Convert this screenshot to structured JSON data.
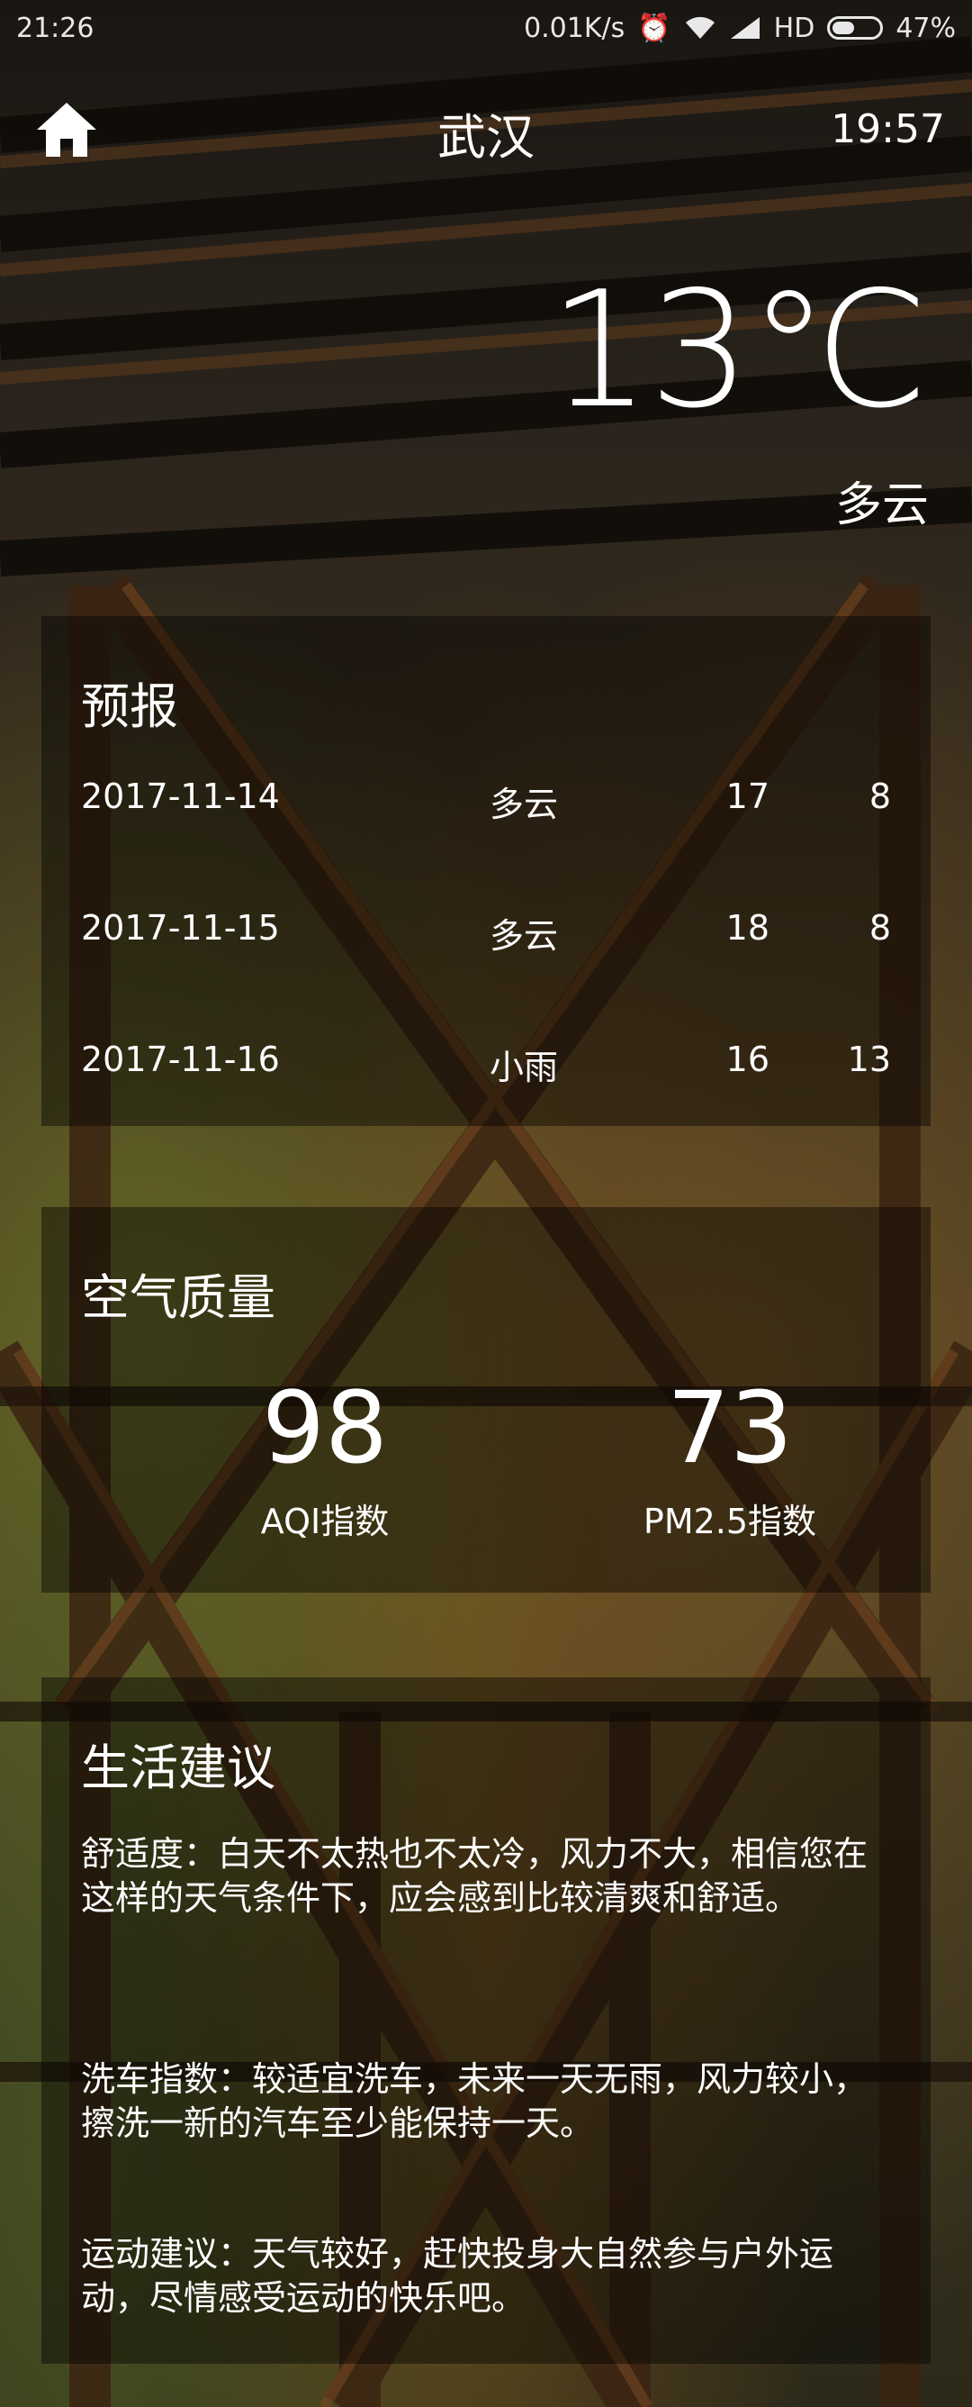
{
  "status_bar": {
    "time": "21:26",
    "net_speed": "0.01K/s",
    "alarm_icon": "alarm-icon",
    "wifi_icon": "wifi-icon",
    "signal_icon": "signal-icon",
    "network_type": "HD",
    "battery_percent": "47%",
    "battery_level": 0.47
  },
  "header": {
    "home_icon": "home-icon",
    "city": "武汉",
    "update_time": "19:57"
  },
  "now": {
    "temperature": "13℃",
    "condition": "多云"
  },
  "forecast": {
    "title": "预报",
    "rows": [
      {
        "date": "2017-11-14",
        "condition": "多云",
        "max": "17",
        "min": "8"
      },
      {
        "date": "2017-11-15",
        "condition": "多云",
        "max": "18",
        "min": "8"
      },
      {
        "date": "2017-11-16",
        "condition": "小雨",
        "max": "16",
        "min": "13"
      }
    ]
  },
  "aqi": {
    "title": "空气质量",
    "aqi_value": "98",
    "aqi_label": "AQI指数",
    "pm25_value": "73",
    "pm25_label": "PM2.5指数"
  },
  "suggestion": {
    "title": "生活建议",
    "comfort": "舒适度：白天不太热也不太冷，风力不大，相信您在这样的天气条件下，应会感到比较清爽和舒适。",
    "car_wash": "洗车指数：较适宜洗车，未来一天无雨，风力较小，擦洗一新的汽车至少能保持一天。",
    "sport": "运动建议：天气较好，赶快投身大自然参与户外运动，尽情感受运动的快乐吧。"
  }
}
